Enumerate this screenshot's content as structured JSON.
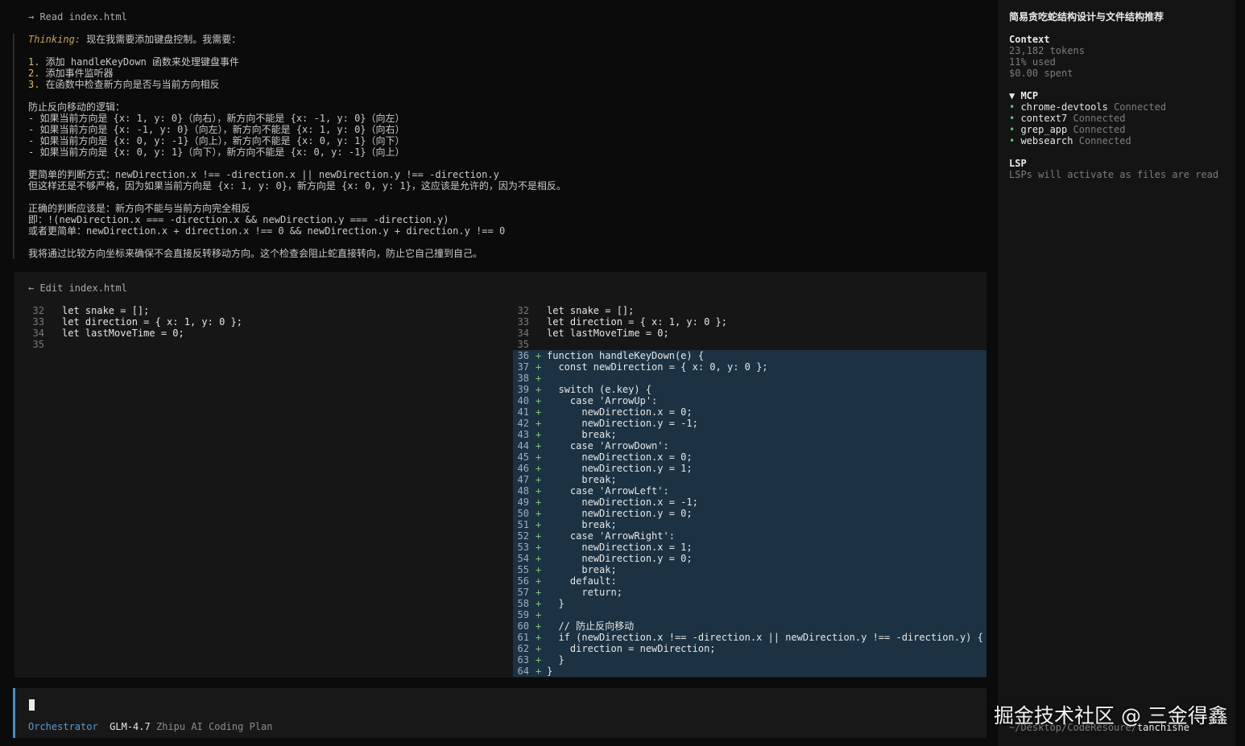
{
  "read": {
    "text": "→ Read index.html"
  },
  "thinking": {
    "label": "Thinking:",
    "intro": " 现在我需要添加键盘控制。我需要：",
    "steps": [
      {
        "num": "1.",
        "text": " 添加 handleKeyDown 函数来处理键盘事件"
      },
      {
        "num": "2.",
        "text": " 添加事件监听器"
      },
      {
        "num": "3.",
        "text": " 在函数中检查新方向是否与当前方向相反"
      }
    ],
    "logic_title": "防止反向移动的逻辑：",
    "logic": [
      "- 如果当前方向是 {x: 1, y: 0}（向右），新方向不能是 {x: -1, y: 0}（向左）",
      "- 如果当前方向是 {x: -1, y: 0}（向左），新方向不能是 {x: 1, y: 0}（向右）",
      "- 如果当前方向是 {x: 0, y: -1}（向上），新方向不能是 {x: 0, y: 1}（向下）",
      "- 如果当前方向是 {x: 0, y: 1}（向下），新方向不能是 {x: 0, y: -1}（向上）"
    ],
    "simple1": "更简单的判断方式：newDirection.x !== -direction.x || newDirection.y !== -direction.y",
    "simple2": "但这样还是不够严格，因为如果当前方向是 {x: 1, y: 0}，新方向是 {x: 0, y: 1}，这应该是允许的，因为不是相反。",
    "correct1": "正确的判断应该是：新方向不能与当前方向完全相反",
    "correct2": "即：!(newDirection.x === -direction.x && newDirection.y === -direction.y)",
    "correct3": "或者更简单：newDirection.x + direction.x !== 0 && newDirection.y + direction.y !== 0",
    "conclusion": "我将通过比较方向坐标来确保不会直接反转移动方向。这个检查会阻止蛇直接转向，防止它自己撞到自己。"
  },
  "edit": {
    "header": "← Edit index.html",
    "left": [
      {
        "n": "32",
        "code": "let snake = [];"
      },
      {
        "n": "33",
        "code": "let direction = { x: 1, y: 0 };"
      },
      {
        "n": "34",
        "code": "let lastMoveTime = 0;"
      },
      {
        "n": "35",
        "code": ""
      }
    ],
    "right": [
      {
        "n": "32",
        "m": "",
        "code": "let snake = [];",
        "add": false
      },
      {
        "n": "33",
        "m": "",
        "code": "let direction = { x: 1, y: 0 };",
        "add": false
      },
      {
        "n": "34",
        "m": "",
        "code": "let lastMoveTime = 0;",
        "add": false
      },
      {
        "n": "35",
        "m": "",
        "code": "",
        "add": false
      },
      {
        "n": "36",
        "m": "+",
        "code": "function handleKeyDown(e) {",
        "add": true
      },
      {
        "n": "37",
        "m": "+",
        "code": "  const newDirection = { x: 0, y: 0 };",
        "add": true
      },
      {
        "n": "38",
        "m": "+",
        "code": "",
        "add": true
      },
      {
        "n": "39",
        "m": "+",
        "code": "  switch (e.key) {",
        "add": true
      },
      {
        "n": "40",
        "m": "+",
        "code": "    case 'ArrowUp':",
        "add": true
      },
      {
        "n": "41",
        "m": "+",
        "code": "      newDirection.x = 0;",
        "add": true
      },
      {
        "n": "42",
        "m": "+",
        "code": "      newDirection.y = -1;",
        "add": true
      },
      {
        "n": "43",
        "m": "+",
        "code": "      break;",
        "add": true
      },
      {
        "n": "44",
        "m": "+",
        "code": "    case 'ArrowDown':",
        "add": true
      },
      {
        "n": "45",
        "m": "+",
        "code": "      newDirection.x = 0;",
        "add": true
      },
      {
        "n": "46",
        "m": "+",
        "code": "      newDirection.y = 1;",
        "add": true
      },
      {
        "n": "47",
        "m": "+",
        "code": "      break;",
        "add": true
      },
      {
        "n": "48",
        "m": "+",
        "code": "    case 'ArrowLeft':",
        "add": true
      },
      {
        "n": "49",
        "m": "+",
        "code": "      newDirection.x = -1;",
        "add": true
      },
      {
        "n": "50",
        "m": "+",
        "code": "      newDirection.y = 0;",
        "add": true
      },
      {
        "n": "51",
        "m": "+",
        "code": "      break;",
        "add": true
      },
      {
        "n": "52",
        "m": "+",
        "code": "    case 'ArrowRight':",
        "add": true
      },
      {
        "n": "53",
        "m": "+",
        "code": "      newDirection.x = 1;",
        "add": true
      },
      {
        "n": "54",
        "m": "+",
        "code": "      newDirection.y = 0;",
        "add": true
      },
      {
        "n": "55",
        "m": "+",
        "code": "      break;",
        "add": true
      },
      {
        "n": "56",
        "m": "+",
        "code": "    default:",
        "add": true
      },
      {
        "n": "57",
        "m": "+",
        "code": "      return;",
        "add": true
      },
      {
        "n": "58",
        "m": "+",
        "code": "  }",
        "add": true
      },
      {
        "n": "59",
        "m": "+",
        "code": "",
        "add": true
      },
      {
        "n": "60",
        "m": "+",
        "code": "  // 防止反向移动",
        "add": true
      },
      {
        "n": "61",
        "m": "+",
        "code": "  if (newDirection.x !== -direction.x || newDirection.y !== -direction.y) {",
        "add": true
      },
      {
        "n": "62",
        "m": "+",
        "code": "    direction = newDirection;",
        "add": true
      },
      {
        "n": "63",
        "m": "+",
        "code": "  }",
        "add": true
      },
      {
        "n": "64",
        "m": "+",
        "code": "}",
        "add": true
      }
    ]
  },
  "input": {
    "mode": "Orchestrator",
    "model": "GLM-4.7",
    "plan": "Zhipu AI Coding Plan"
  },
  "sidebar": {
    "title": "简易贪吃蛇结构设计与文件结构推荐",
    "context_head": "Context",
    "tokens": "23,182 tokens",
    "used": "11% used",
    "spent": "$0.00 spent",
    "mcp_head": "▼ MCP",
    "mcp": [
      {
        "name": "chrome-devtools",
        "status": "Connected"
      },
      {
        "name": "context7",
        "status": "Connected"
      },
      {
        "name": "grep_app",
        "status": "Connected"
      },
      {
        "name": "websearch",
        "status": "Connected"
      }
    ],
    "lsp_head": "LSP",
    "lsp_text": "LSPs will activate as files are read",
    "path_prefix": "~/Desktop/CodeResoure/",
    "path_dir": "tanchishe"
  },
  "watermark": "掘金技术社区 @ 三金得鑫"
}
